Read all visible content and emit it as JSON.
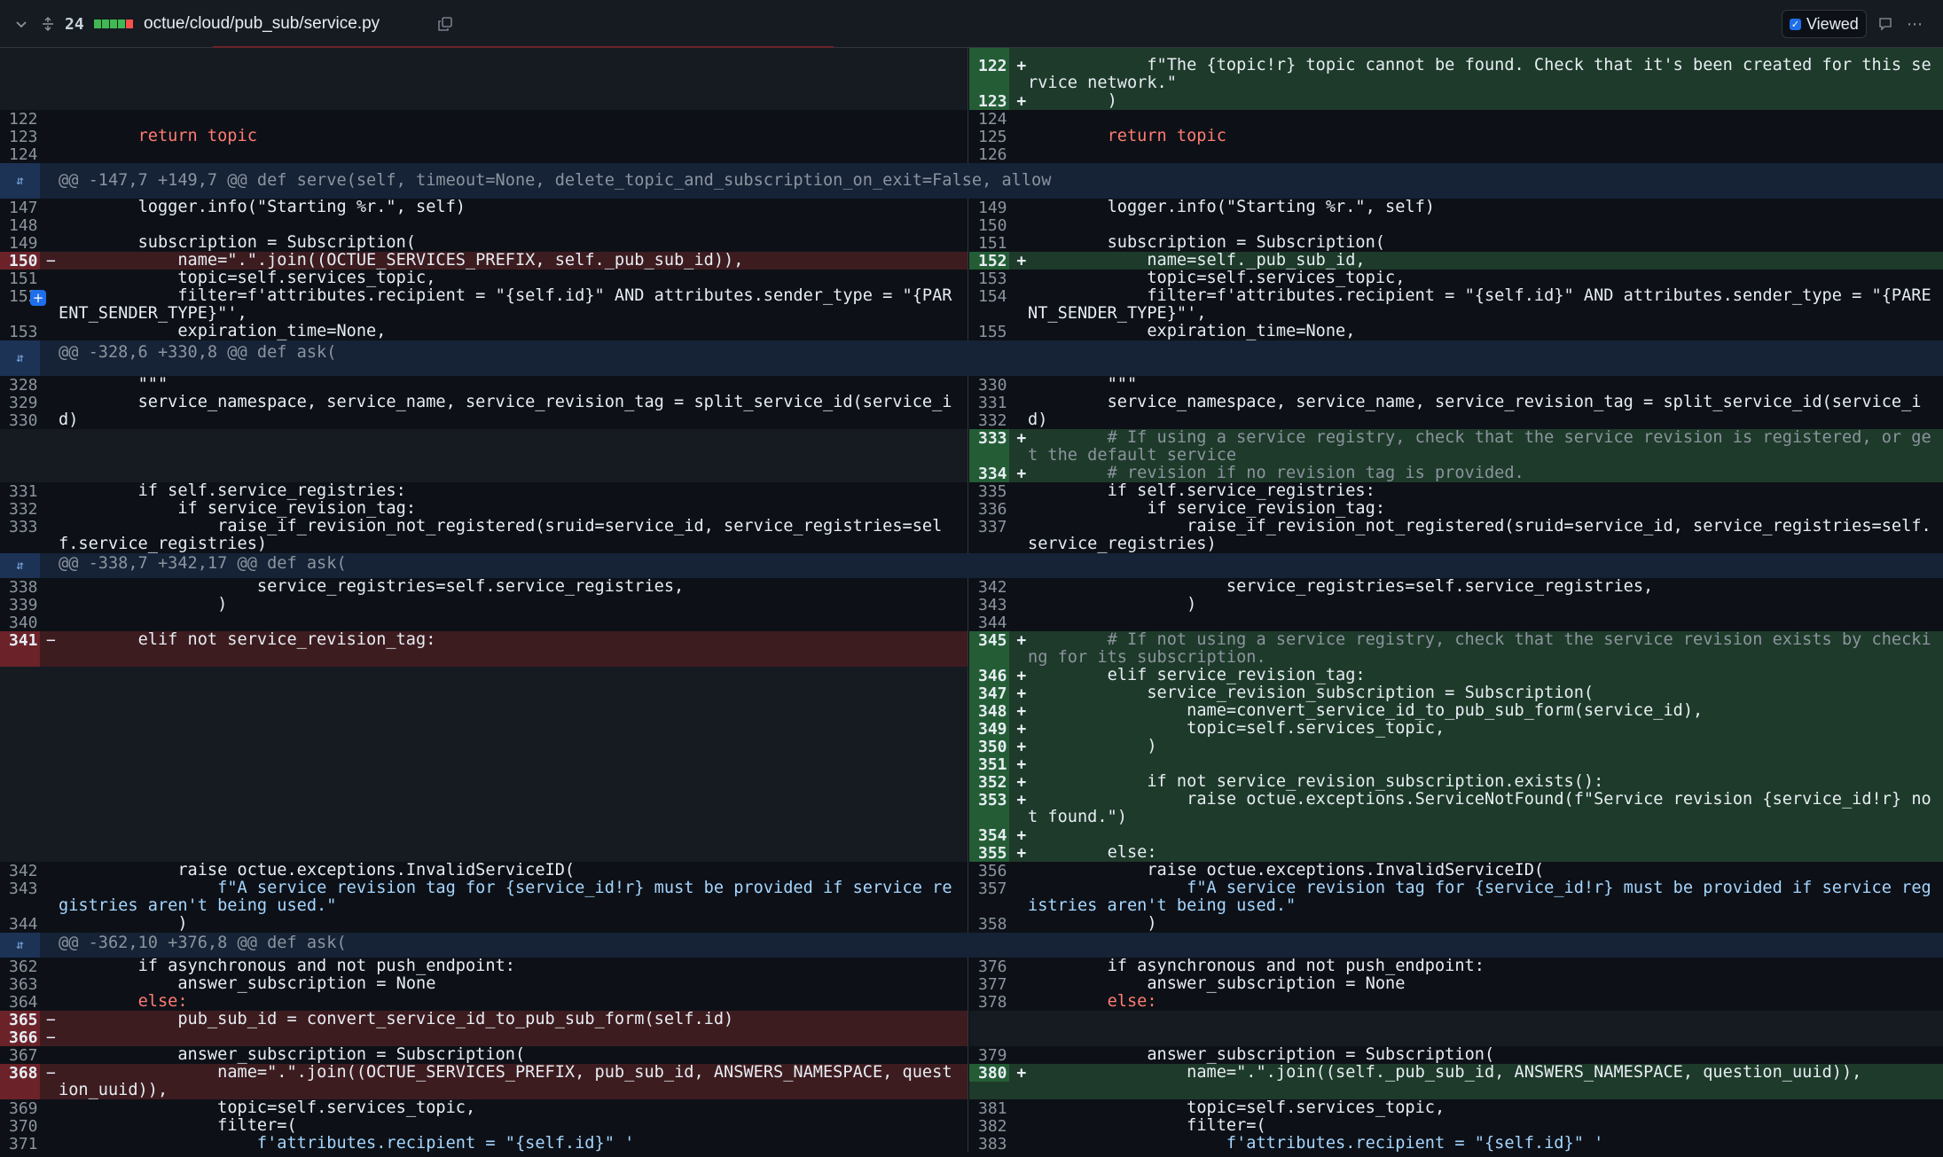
{
  "header": {
    "lines_changed": "24",
    "file_path": "octue/cloud/pub_sub/service.py",
    "viewed_label": "Viewed",
    "colors": {
      "added": "#3fb950",
      "removed": "#f85149",
      "neutral": "#6e7681"
    }
  },
  "hunks": [
    "@@ -147,7 +149,7 @@ def serve(self, timeout=None, delete_topic_and_subscription_on_exit=False, allow",
    "@@ -328,6 +330,8 @@ def ask(",
    "@@ -338,7 +342,17 @@ def ask(",
    "@@ -362,10 +376,8 @@ def ask("
  ],
  "line_numbers": {
    "l122": "122",
    "l123": "123",
    "l124": "124",
    "l147": "147",
    "l148": "148",
    "l149": "149",
    "l150": "150",
    "l151": "151",
    "l152": "152",
    "l153": "153",
    "l328": "328",
    "l329": "329",
    "l330": "330",
    "l331": "331",
    "l332": "332",
    "l333": "333",
    "l338": "338",
    "l339": "339",
    "l340": "340",
    "l341": "341",
    "l342": "342",
    "l343": "343",
    "l344": "344",
    "l362": "362",
    "l363": "363",
    "l364": "364",
    "l365": "365",
    "l366": "366",
    "l367": "367",
    "l368": "368",
    "l369": "369",
    "l370": "370",
    "l371": "371",
    "r122": "122 +",
    "r123": "123 +",
    "r124": "124",
    "r125": "125",
    "r126": "126",
    "r149": "149",
    "r150": "150",
    "r151": "151",
    "r152": "152 +",
    "r153": "153",
    "r154": "154",
    "r155": "155",
    "r330": "330",
    "r331": "331",
    "r332": "332",
    "r333": "333 +",
    "r334": "334 +",
    "r335": "335",
    "r336": "336",
    "r337": "337",
    "r342": "342",
    "r343": "343",
    "r344": "344",
    "r345": "345 +",
    "r346": "346 +",
    "r347": "347 +",
    "r348": "348 +",
    "r349": "349 +",
    "r350": "350 +",
    "r351": "351 +",
    "r352": "352 +",
    "r353": "353 +",
    "r354": "354 +",
    "r355": "355 +",
    "r356": "356",
    "r357": "357",
    "r358": "358",
    "r376": "376",
    "r377": "377",
    "r378": "378",
    "r379": "379",
    "r380": "380 +",
    "r381": "381",
    "r382": "382",
    "r383": "383"
  },
  "code": {
    "r122": "            f\"The {topic!r} topic cannot be found. Check that it's been created for this service network.\"",
    "r123": "        )",
    "l123": "        return topic",
    "r125": "        return topic",
    "l147": "        logger.info(\"Starting %r.\", self)",
    "r149": "        logger.info(\"Starting %r.\", self)",
    "l149": "        subscription = Subscription(",
    "r151": "        subscription = Subscription(",
    "l150": "            name=\".\".join((OCTUE_SERVICES_PREFIX, self._pub_sub_id)),",
    "r152": "            name=self._pub_sub_id,",
    "l151": "            topic=self.services_topic,",
    "r153": "            topic=self.services_topic,",
    "l152": "            filter=f'attributes.recipient = \"{self.id}\" AND attributes.sender_type = \"{PARENT_SENDER_TYPE}\"',",
    "r154": "            filter=f'attributes.recipient = \"{self.id}\" AND attributes.sender_type = \"{PARENT_SENDER_TYPE}\"',",
    "l153": "            expiration_time=None,",
    "r155": "            expiration_time=None,",
    "l328": "        \"\"\"",
    "r330": "        \"\"\"",
    "l329": "        service_namespace, service_name, service_revision_tag = split_service_id(service_id)",
    "r331": "        service_namespace, service_name, service_revision_tag = split_service_id(service_id)",
    "r333": "        # If using a service registry, check that the service revision is registered, or get the default service",
    "r334": "        # revision if no revision tag is provided.",
    "l331": "        if self.service_registries:",
    "r335": "        if self.service_registries:",
    "l332": "            if service_revision_tag:",
    "r336": "            if service_revision_tag:",
    "l333": "                raise_if_revision_not_registered(sruid=service_id, service_registries=self.service_registries)",
    "r337": "                raise_if_revision_not_registered(sruid=service_id, service_registries=self.service_registries)",
    "l338": "                    service_registries=self.service_registries,",
    "r342": "                    service_registries=self.service_registries,",
    "l339": "                )",
    "r343": "                )",
    "l341": "        elif not service_revision_tag:",
    "r345": "        # If not using a service registry, check that the service revision exists by checking for its subscription.",
    "r346": "        elif service_revision_tag:",
    "r347": "            service_revision_subscription = Subscription(",
    "r348": "                name=convert_service_id_to_pub_sub_form(service_id),",
    "r349": "                topic=self.services_topic,",
    "r350": "            )",
    "r352": "            if not service_revision_subscription.exists():",
    "r353": "                raise octue.exceptions.ServiceNotFound(f\"Service revision {service_id!r} not found.\")",
    "r355": "        else:",
    "l342": "            raise octue.exceptions.InvalidServiceID(",
    "r356": "            raise octue.exceptions.InvalidServiceID(",
    "l343": "                f\"A service revision tag for {service_id!r} must be provided if service registries aren't being used.\"",
    "r357": "                f\"A service revision tag for {service_id!r} must be provided if service registries aren't being used.\"",
    "l344": "            )",
    "r358": "            )",
    "l362": "        if asynchronous and not push_endpoint:",
    "r376": "        if asynchronous and not push_endpoint:",
    "l363": "            answer_subscription = None",
    "r377": "            answer_subscription = None",
    "l364": "        else:",
    "r378": "        else:",
    "l365": "            pub_sub_id = convert_service_id_to_pub_sub_form(self.id)",
    "l367": "            answer_subscription = Subscription(",
    "r379": "            answer_subscription = Subscription(",
    "l368": "                name=\".\".join((OCTUE_SERVICES_PREFIX, pub_sub_id, ANSWERS_NAMESPACE, question_uuid)),",
    "r380": "                name=\".\".join((self._pub_sub_id, ANSWERS_NAMESPACE, question_uuid)),",
    "l369": "                topic=self.services_topic,",
    "r381": "                topic=self.services_topic,",
    "l370": "                filter=(",
    "r382": "                filter=(",
    "l371": "                    f'attributes.recipient = \"{self.id}\" '",
    "r383": "                    f'attributes.recipient = \"{self.id}\" '"
  }
}
